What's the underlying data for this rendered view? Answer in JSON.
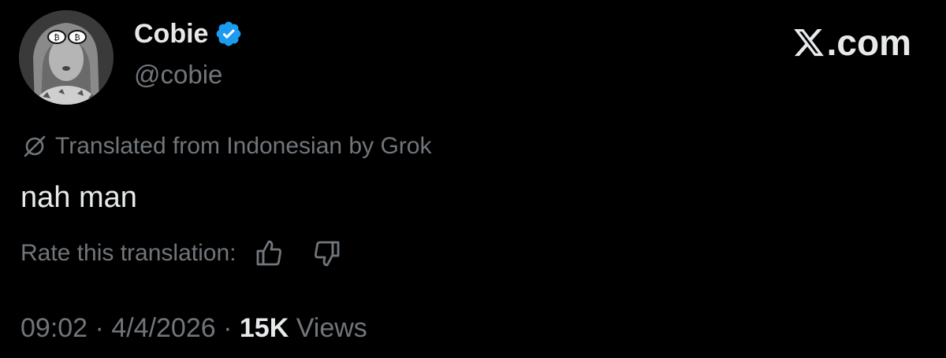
{
  "author": {
    "display_name": "Cobie",
    "handle": "@cobie",
    "verified": true,
    "verified_color": "#1d9bf0",
    "avatar_icon": "profile-photo"
  },
  "brand": {
    "text": ".com",
    "icon": "x-logo-icon"
  },
  "translation": {
    "label": "Translated from Indonesian by Grok",
    "icon": "grok-icon"
  },
  "tweet": {
    "text": "nah man"
  },
  "rating": {
    "label": "Rate this translation:",
    "up_icon": "thumbs-up-icon",
    "down_icon": "thumbs-down-icon"
  },
  "meta": {
    "time": "09:02",
    "separator": " · ",
    "date": "4/4/2026",
    "views_count": "15K",
    "views_label": "Views"
  },
  "colors": {
    "background": "#000000",
    "primary_text": "#e7e9ea",
    "secondary_text": "#71767b"
  }
}
